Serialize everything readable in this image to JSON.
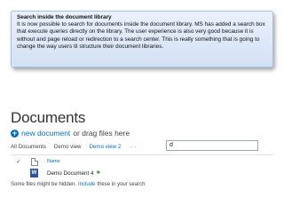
{
  "callout": {
    "title": "Search inside the document library",
    "body": "It is now possible to search for documents inside the document library. MS has added a search box that execute queries directly on the library. The user experience is also very good because it is without and page reload or redirection to a search center. This is really something that is going to change the way users til structure their document libraries."
  },
  "library": {
    "title": "Documents",
    "new_doc_link": "new document",
    "new_doc_suffix": "or drag files here",
    "new_doc_icon": "plus-circle-icon",
    "views": [
      "All Documents",
      "Demo view",
      "Demo view 2"
    ],
    "active_view": "Demo view 2",
    "ellipsis": "···",
    "search_value": "d",
    "column_name": "Name",
    "documents": [
      {
        "name": "Demo Document 4",
        "badge": "✱"
      }
    ],
    "hidden_prefix": "Some files might be hidden.",
    "hidden_link": "Include",
    "hidden_suffix": "these in your search"
  }
}
